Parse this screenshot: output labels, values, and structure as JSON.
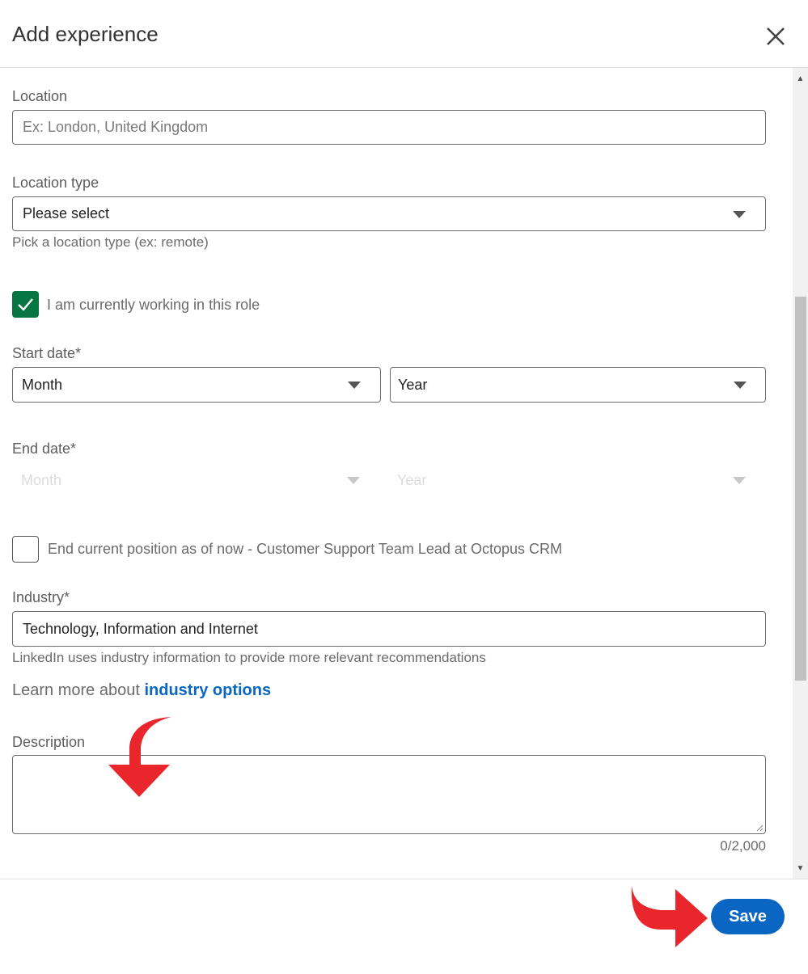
{
  "modal": {
    "title": "Add experience",
    "close_icon": "close-icon"
  },
  "form": {
    "location": {
      "label": "Location",
      "placeholder": "Ex: London, United Kingdom",
      "value": ""
    },
    "location_type": {
      "label": "Location type",
      "selected": "Please select",
      "hint": "Pick a location type (ex: remote)"
    },
    "currently_working": {
      "label": "I am currently working in this role",
      "checked": true
    },
    "start_date": {
      "label": "Start date*",
      "month": "Month",
      "year": "Year"
    },
    "end_date": {
      "label": "End date*",
      "month": "Month",
      "year": "Year",
      "disabled": true
    },
    "end_current": {
      "label": "End current position as of now - Customer Support Team Lead at Octopus CRM",
      "checked": false
    },
    "industry": {
      "label": "Industry*",
      "value": "Technology, Information and Internet",
      "hint": "LinkedIn uses industry information to provide more relevant recommendations",
      "learn_more_prefix": "Learn more about",
      "learn_more_link": "industry options"
    },
    "description": {
      "label": "Description",
      "value": "",
      "counter": "0/2,000"
    }
  },
  "footer": {
    "save_label": "Save"
  },
  "colors": {
    "accent": "#0a66c2",
    "checkbox": "#057642",
    "annotation_arrow": "#e8262c"
  }
}
